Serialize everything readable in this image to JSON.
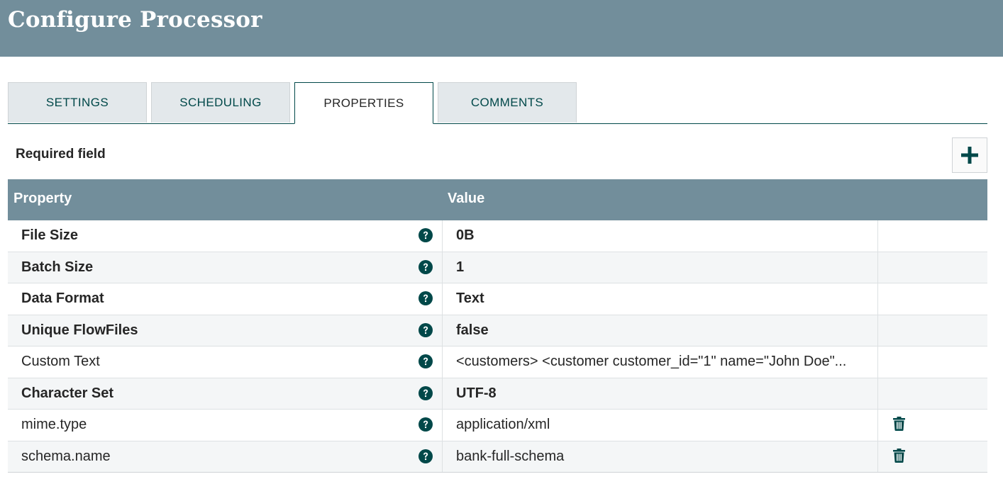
{
  "dialog": {
    "title": "Configure Processor"
  },
  "tabs": [
    {
      "label": "SETTINGS",
      "active": false
    },
    {
      "label": "SCHEDULING",
      "active": false
    },
    {
      "label": "PROPERTIES",
      "active": true
    },
    {
      "label": "COMMENTS",
      "active": false
    }
  ],
  "properties_panel": {
    "required_label": "Required field",
    "add_button_icon": "plus-icon",
    "columns": {
      "property": "Property",
      "value": "Value"
    },
    "rows": [
      {
        "name": "File Size",
        "value": "0B",
        "required": true,
        "deletable": false
      },
      {
        "name": "Batch Size",
        "value": "1",
        "required": true,
        "deletable": false
      },
      {
        "name": "Data Format",
        "value": "Text",
        "required": true,
        "deletable": false
      },
      {
        "name": "Unique FlowFiles",
        "value": "false",
        "required": true,
        "deletable": false
      },
      {
        "name": "Custom Text",
        "value": "<customers> <customer customer_id=\"1\" name=\"John Doe\"...",
        "required": false,
        "deletable": false
      },
      {
        "name": "Character Set",
        "value": "UTF-8",
        "required": true,
        "deletable": false
      },
      {
        "name": "mime.type",
        "value": "application/xml",
        "required": false,
        "deletable": true
      },
      {
        "name": "schema.name",
        "value": "bank-full-schema",
        "required": false,
        "deletable": true
      }
    ]
  },
  "colors": {
    "header_bg": "#728e9b",
    "accent": "#004849",
    "tab_bg": "#e3e8eb"
  }
}
